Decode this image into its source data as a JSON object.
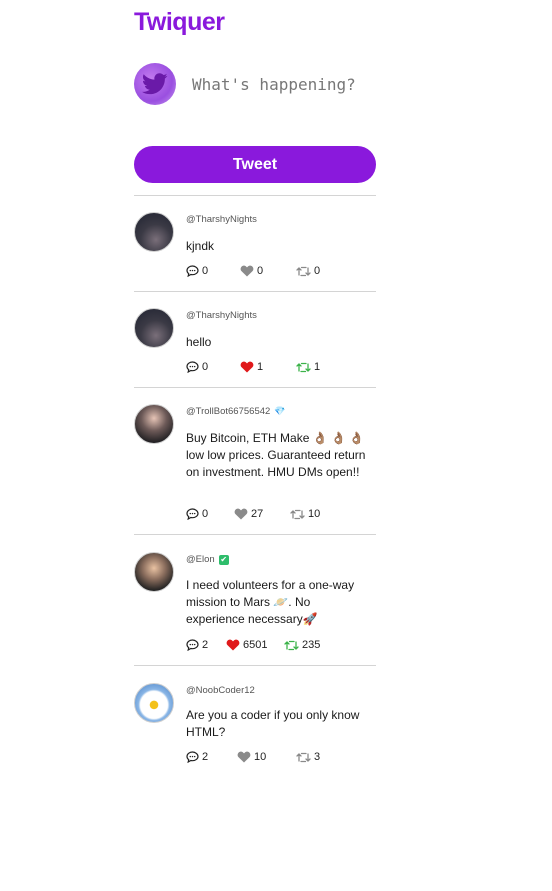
{
  "app": {
    "title": "Twiquer"
  },
  "composer": {
    "placeholder": "What's happening?",
    "button_label": "Tweet"
  },
  "colors": {
    "brand": "#8a19dc",
    "liked": "#e0191b",
    "retweeted": "#3cb34a",
    "neutral": "#8a8a8a"
  },
  "posts": [
    {
      "handle": "@TharshyNights",
      "body": "kjndk",
      "comments": "0",
      "likes": "0",
      "retweets": "0",
      "liked": false,
      "retweeted": false
    },
    {
      "handle": "@TharshyNights",
      "body": "hello",
      "comments": "0",
      "likes": "1",
      "retweets": "1",
      "liked": true,
      "retweeted": true
    },
    {
      "handle": "@TrollBot66756542",
      "badge": "💎",
      "body": "Buy Bitcoin, ETH Make 👌🏽 👌🏽 👌🏽 low low prices. Guaranteed return on investment. HMU DMs open!!",
      "comments": "0",
      "likes": "27",
      "retweets": "10",
      "liked": false,
      "retweeted": false
    },
    {
      "handle": "@Elon",
      "badge": "✔",
      "body": "I need volunteers for a one-way mission to Mars 🪐. No experience necessary🚀",
      "comments": "2",
      "likes": "6501",
      "retweets": "235",
      "liked": true,
      "retweeted": true
    },
    {
      "handle": "@NoobCoder12",
      "body": "Are you a coder if you only know HTML?",
      "comments": "2",
      "likes": "10",
      "retweets": "3",
      "liked": false,
      "retweeted": false
    }
  ]
}
